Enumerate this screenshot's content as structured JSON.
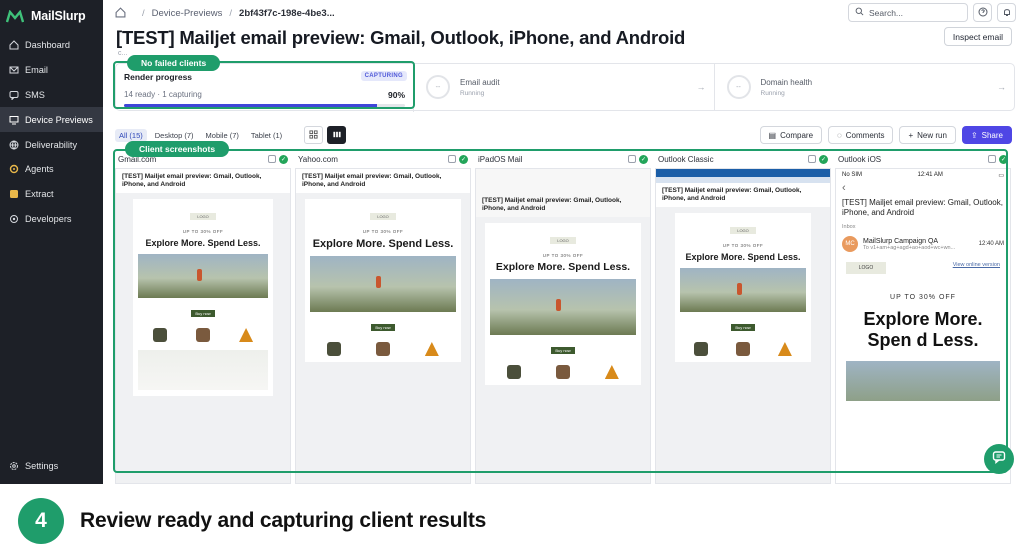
{
  "brand": {
    "name": "MailSlurp"
  },
  "sidebar": {
    "items": [
      {
        "label": "Dashboard",
        "icon": "home-icon"
      },
      {
        "label": "Email",
        "icon": "mail-icon"
      },
      {
        "label": "SMS",
        "icon": "message-icon"
      },
      {
        "label": "Device Previews",
        "icon": "device-icon",
        "active": true
      },
      {
        "label": "Deliverability",
        "icon": "globe-icon"
      },
      {
        "label": "Agents",
        "icon": "agent-icon"
      },
      {
        "label": "Extract",
        "icon": "extract-icon"
      },
      {
        "label": "Developers",
        "icon": "developer-icon"
      }
    ],
    "settings": "Settings"
  },
  "breadcrumb": {
    "section": "Device-Previews",
    "id": "2bf43f7c-198e-4be3..."
  },
  "search": {
    "placeholder": "Search..."
  },
  "page": {
    "title": "[TEST] Mailjet email preview: Gmail, Outlook, iPhone, and Android",
    "inspect_label": "Inspect email",
    "subline": "c..."
  },
  "render_progress": {
    "title": "Render progress",
    "badge": "CAPTURING",
    "summary": "14 ready · 1 capturing",
    "percent_label": "90%",
    "percent": 90
  },
  "status_cards": [
    {
      "title": "Email audit",
      "status": "Running",
      "ring": "--"
    },
    {
      "title": "Domain health",
      "status": "Running",
      "ring": "--"
    }
  ],
  "filters": [
    "All (15)",
    "Desktop (7)",
    "Mobile (7)",
    "Tablet (1)"
  ],
  "actions": {
    "compare": "Compare",
    "comments": "Comments",
    "new_run": "New run",
    "share": "Share"
  },
  "clients": [
    {
      "name": "Gmail.com"
    },
    {
      "name": "Yahoo.com"
    },
    {
      "name": "iPadOS Mail"
    },
    {
      "name": "Outlook Classic"
    },
    {
      "name": "Outlook iOS"
    }
  ],
  "email_preview": {
    "subject": "[TEST] Mailjet email preview: Gmail, Outlook, iPhone, and Android",
    "logo": "LOGO",
    "promo": "UP TO 30% OFF",
    "headline": "Explore More. Spend Less.",
    "buy": "Buy now"
  },
  "ios_preview": {
    "carrier": "No SIM",
    "clock": "12:41 AM",
    "back": "‹",
    "subject": "[TEST] Mailjet email preview: Gmail, Outlook, iPhone, and Android",
    "folder": "Inbox",
    "avatar": "MC",
    "from": "MailSlurp Campaign QA",
    "to": "To v1+am+ag+agd+ao+aod+wc+wn...",
    "time": "12:40 AM",
    "view_online": "View online version",
    "promo": "UP TO 30% OFF",
    "headline": "Explore More. Spen d Less."
  },
  "highlights": {
    "no_failed": "No failed clients",
    "client_screenshots": "Client screenshots"
  },
  "caption": {
    "step": "4",
    "text": "Review ready and capturing client results"
  },
  "colors": {
    "accent": "#1f9d6b",
    "sidebar": "#1d2027",
    "primary": "#4f46e5"
  }
}
